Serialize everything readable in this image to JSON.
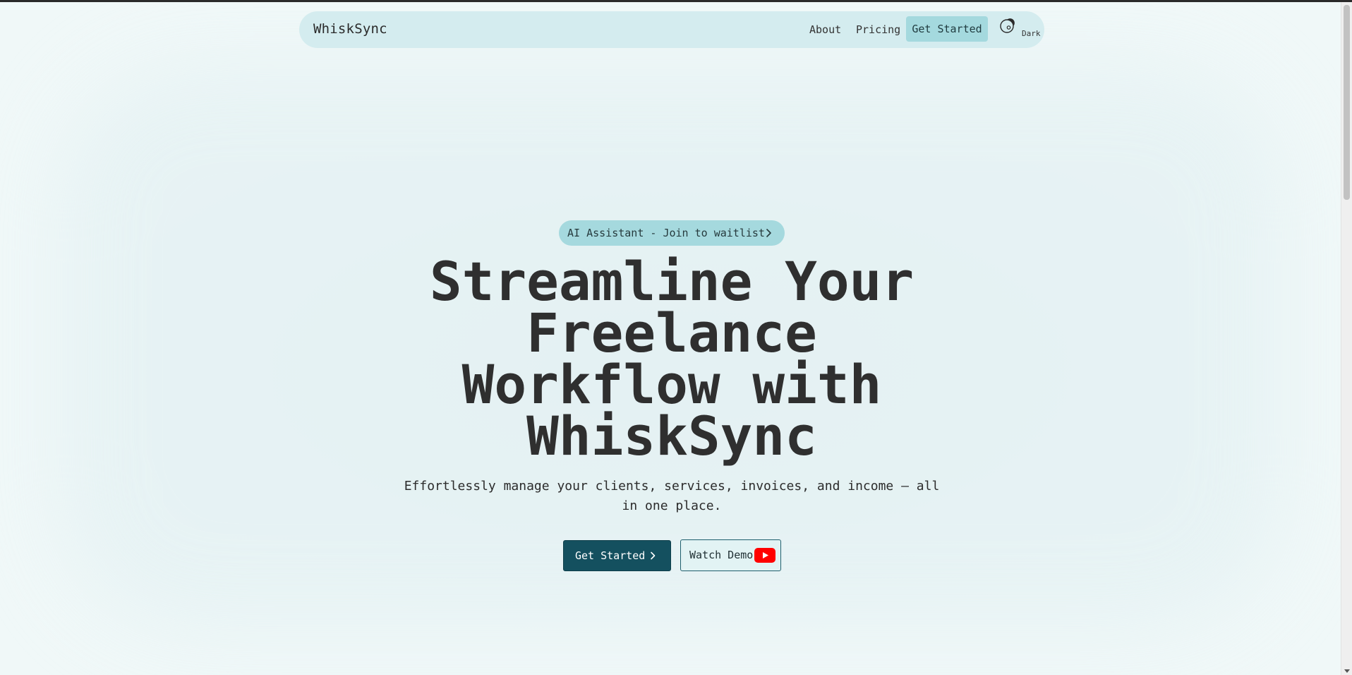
{
  "navbar": {
    "brand": "WhiskSync",
    "links": [
      "About",
      "Pricing"
    ],
    "cta_label": "Get Started",
    "theme_toggle_label": "Dark",
    "theme_icon": "moon-icon"
  },
  "hero": {
    "badge_label": "AI Assistant - Join to waitlist",
    "badge_icon": "chevron-right-icon",
    "headline_lines": [
      "Streamline Your",
      "Freelance",
      "Workflow with",
      "WhiskSync"
    ],
    "subhead_lines": [
      "Effortlessly manage your clients, services, invoices, and income — all",
      "in one place."
    ],
    "primary_button_label": "Get Started",
    "primary_button_icon": "chevron-right-icon",
    "secondary_button_label": "Watch Demo",
    "secondary_button_icon": "youtube-icon"
  },
  "colors": {
    "navbar_bg": "#d4ecef",
    "accent": "#a4d9de",
    "primary_button": "#14505f",
    "youtube_red": "#ff0000"
  }
}
